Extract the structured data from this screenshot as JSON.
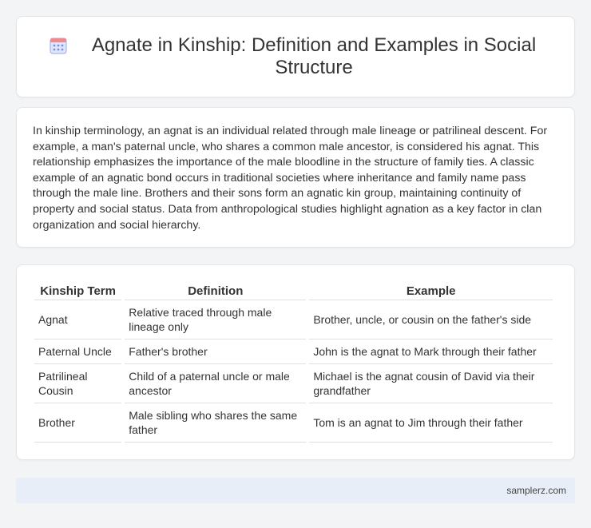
{
  "header": {
    "title": "Agnate in Kinship: Definition and Examples in Social Structure",
    "icon": "calendar-grid-icon"
  },
  "intro": {
    "text": "In kinship terminology, an agnat is an individual related through male lineage or patrilineal descent. For example, a man's paternal uncle, who shares a common male ancestor, is considered his agnat. This relationship emphasizes the importance of the male bloodline in the structure of family ties. A classic example of an agnatic bond occurs in traditional societies where inheritance and family name pass through the male line. Brothers and their sons form an agnatic kin group, maintaining continuity of property and social status. Data from anthropological studies highlight agnation as a key factor in clan organization and social hierarchy."
  },
  "table": {
    "headers": [
      "Kinship Term",
      "Definition",
      "Example"
    ],
    "rows": [
      [
        "Agnat",
        "Relative traced through male lineage only",
        "Brother, uncle, or cousin on the father's side"
      ],
      [
        "Paternal Uncle",
        "Father's brother",
        "John is the agnat to Mark through their father"
      ],
      [
        "Patrilineal Cousin",
        "Child of a paternal uncle or male ancestor",
        "Michael is the agnat cousin of David via their grandfather"
      ],
      [
        "Brother",
        "Male sibling who shares the same father",
        "Tom is an agnat to Jim through their father"
      ]
    ]
  },
  "footer": {
    "site": "samplerz.com"
  },
  "colors": {
    "page_background": "#f3f4f6",
    "card_background": "#ffffff",
    "footer_background": "#e8eef8",
    "icon_accent": "#7b8fe0",
    "icon_header": "#e57373"
  }
}
